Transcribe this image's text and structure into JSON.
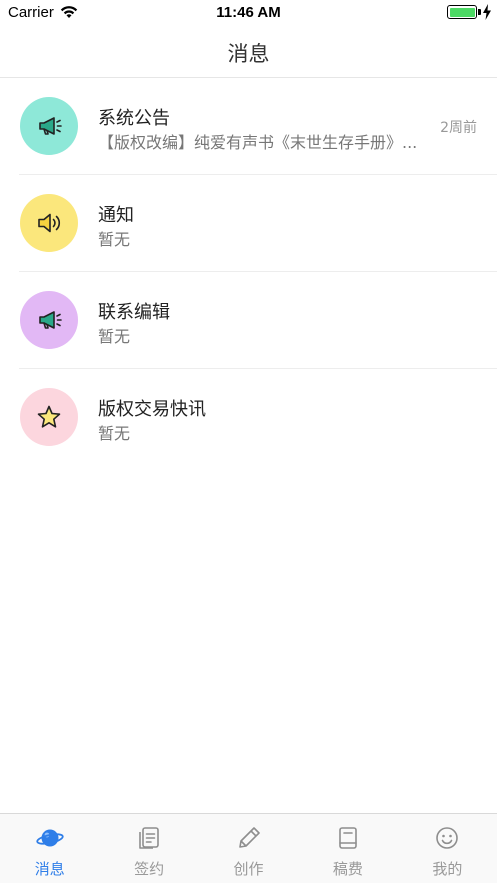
{
  "status_bar": {
    "carrier": "Carrier",
    "time": "11:46 AM"
  },
  "nav": {
    "title": "消息"
  },
  "messages": [
    {
      "title": "系统公告",
      "subtitle": "【版权改编】纯爱有声书《末世生存手册》...",
      "time": "2周前",
      "icon": "megaphone-icon",
      "color": "#8ee8d8"
    },
    {
      "title": "通知",
      "subtitle": "暂无",
      "time": "",
      "icon": "speaker-icon",
      "color": "#fbe77c"
    },
    {
      "title": "联系编辑",
      "subtitle": "暂无",
      "time": "",
      "icon": "megaphone-icon",
      "color": "#e2b8f5"
    },
    {
      "title": "版权交易快讯",
      "subtitle": "暂无",
      "time": "",
      "icon": "star-icon",
      "color": "#fcd6de"
    }
  ],
  "tabs": [
    {
      "label": "消息",
      "icon": "planet-icon",
      "active": true
    },
    {
      "label": "签约",
      "icon": "contract-icon",
      "active": false
    },
    {
      "label": "创作",
      "icon": "pencil-icon",
      "active": false
    },
    {
      "label": "稿费",
      "icon": "book-icon",
      "active": false
    },
    {
      "label": "我的",
      "icon": "smiley-icon",
      "active": false
    }
  ],
  "colors": {
    "accent": "#2f7ee8",
    "battery": "#4cd964"
  }
}
